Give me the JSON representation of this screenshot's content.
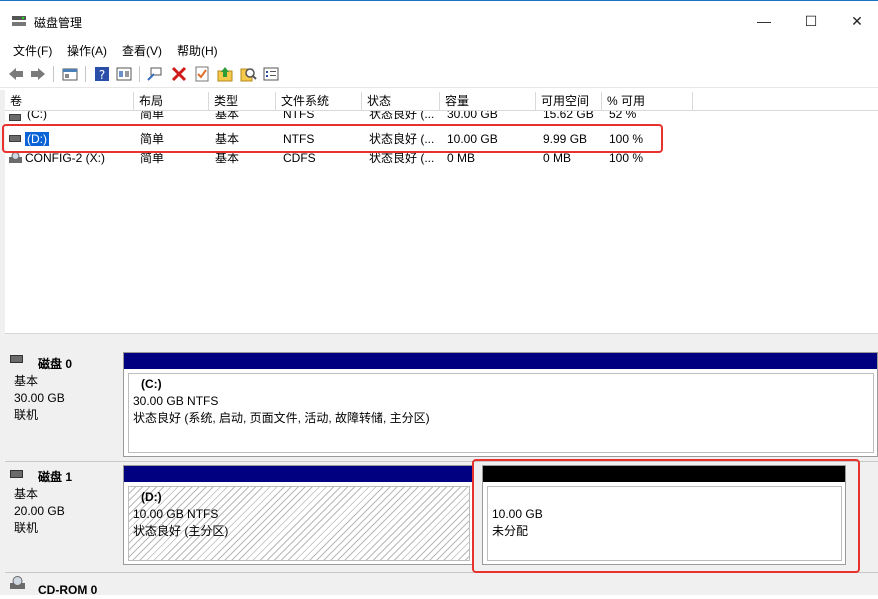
{
  "window": {
    "title": "磁盘管理",
    "minimize": "—",
    "maximize": "☐",
    "close": "✕"
  },
  "menu": [
    "文件(F)",
    "操作(A)",
    "查看(V)",
    "帮助(H)"
  ],
  "toolbar_icons": [
    "back-icon",
    "forward-icon",
    "console-icon",
    "help-icon",
    "view-icon",
    "connect-icon",
    "delete-icon",
    "check-icon",
    "folder-up-icon",
    "search-icon",
    "properties-icon"
  ],
  "columns": [
    "卷",
    "布局",
    "类型",
    "文件系统",
    "状态",
    "容量",
    "可用空间",
    "% 可用"
  ],
  "volumes": [
    {
      "name": "(C:)",
      "layout": "简单",
      "type": "基本",
      "fs": "NTFS",
      "status": "状态良好 (...",
      "capacity": "30.00 GB",
      "free": "15.62 GB",
      "pct": "52 %"
    },
    {
      "name": "(D:)",
      "layout": "简单",
      "type": "基本",
      "fs": "NTFS",
      "status": "状态良好 (...",
      "capacity": "10.00 GB",
      "free": "9.99 GB",
      "pct": "100 %"
    },
    {
      "name": "CONFIG-2 (X:)",
      "layout": "简单",
      "type": "基本",
      "fs": "CDFS",
      "status": "状态良好 (...",
      "capacity": "0 MB",
      "free": "0 MB",
      "pct": "100 %"
    }
  ],
  "disks": [
    {
      "name": "磁盘 0",
      "kind": "基本",
      "size": "30.00 GB",
      "state": "联机",
      "partitions": [
        {
          "label": "(C:)",
          "size": "30.00 GB NTFS",
          "status": "状态良好 (系统, 启动, 页面文件, 活动, 故障转储, 主分区)"
        }
      ]
    },
    {
      "name": "磁盘 1",
      "kind": "基本",
      "size": "20.00 GB",
      "state": "联机",
      "partitions": [
        {
          "label": "(D:)",
          "size": "10.00 GB NTFS",
          "status": "状态良好 (主分区)"
        },
        {
          "label": "",
          "size": "10.00 GB",
          "status": "未分配"
        }
      ]
    },
    {
      "name": "CD-ROM 0"
    }
  ],
  "colors": {
    "primary_bar": "#000080",
    "unallocated_bar": "#000000",
    "selection": "#0a64d8",
    "highlight": "#e8322d"
  }
}
